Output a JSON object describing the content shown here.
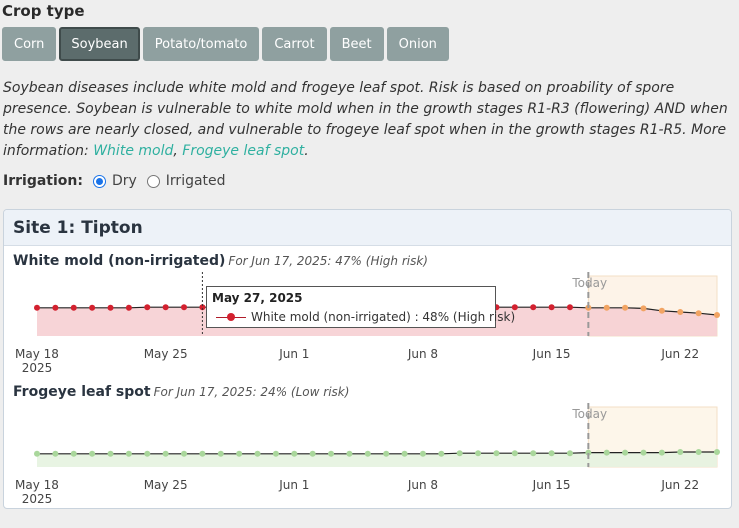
{
  "crop_type": {
    "title": "Crop type",
    "tabs": [
      "Corn",
      "Soybean",
      "Potato/tomato",
      "Carrot",
      "Beet",
      "Onion"
    ],
    "active": "Soybean"
  },
  "description": {
    "text": "Soybean diseases include white mold and frogeye leaf spot. Risk is based on proability of spore presence. Soybean is vulnerable to white mold when in the growth stages R1-R3 (flowering) AND when the rows are nearly closed, and vulnerable to frogeye leaf spot when in the growth stages R1-R5. More information: ",
    "link1": "White mold",
    "sep": ", ",
    "link2": "Frogeye leaf spot",
    "end": "."
  },
  "irrigation": {
    "label": "Irrigation:",
    "options": [
      "Dry",
      "Irrigated"
    ],
    "selected": "Dry"
  },
  "site": {
    "title": "Site 1: Tipton"
  },
  "charts": {
    "white_mold": {
      "title": "White mold (non-irrigated)",
      "subtitle": "For Jun 17, 2025: 47% (High risk)",
      "today_label": "Today",
      "tooltip": {
        "date": "May 27, 2025",
        "text": "White mold (non-irrigated) : 48% (High risk)"
      }
    },
    "frogeye": {
      "title": "Frogeye leaf spot",
      "subtitle": "For Jun 17, 2025: 24% (Low risk)",
      "today_label": "Today"
    },
    "x_ticks": [
      "May 18",
      "May 25",
      "Jun 1",
      "Jun 8",
      "Jun 15",
      "Jun 22"
    ],
    "x_year": "2025"
  },
  "chart_data": [
    {
      "type": "line",
      "title": "White mold (non-irrigated)",
      "x": [
        "2025-05-18",
        "2025-05-19",
        "2025-05-20",
        "2025-05-21",
        "2025-05-22",
        "2025-05-23",
        "2025-05-24",
        "2025-05-25",
        "2025-05-26",
        "2025-05-27",
        "2025-05-28",
        "2025-05-29",
        "2025-05-30",
        "2025-05-31",
        "2025-06-01",
        "2025-06-02",
        "2025-06-03",
        "2025-06-04",
        "2025-06-05",
        "2025-06-06",
        "2025-06-07",
        "2025-06-08",
        "2025-06-09",
        "2025-06-10",
        "2025-06-11",
        "2025-06-12",
        "2025-06-13",
        "2025-06-14",
        "2025-06-15",
        "2025-06-16",
        "2025-06-17",
        "2025-06-18",
        "2025-06-19",
        "2025-06-20",
        "2025-06-21",
        "2025-06-22",
        "2025-06-23",
        "2025-06-24"
      ],
      "series": [
        {
          "name": "White mold (non-irrigated)",
          "values": [
            47,
            47,
            47,
            47,
            47,
            47,
            48,
            48,
            48,
            48,
            48,
            48,
            48,
            48,
            48,
            48,
            48,
            48,
            48,
            48,
            48,
            48,
            48,
            48,
            48,
            48,
            48,
            48,
            48,
            48,
            47,
            47,
            47,
            46,
            42,
            40,
            38,
            35
          ]
        }
      ],
      "forecast_from": "2025-06-17",
      "risk_bands": {
        "high": "#f6cfd3",
        "forecast_bg": "#fdf3e8"
      }
    },
    {
      "type": "line",
      "title": "Frogeye leaf spot",
      "x": [
        "2025-05-18",
        "2025-05-19",
        "2025-05-20",
        "2025-05-21",
        "2025-05-22",
        "2025-05-23",
        "2025-05-24",
        "2025-05-25",
        "2025-05-26",
        "2025-05-27",
        "2025-05-28",
        "2025-05-29",
        "2025-05-30",
        "2025-05-31",
        "2025-06-01",
        "2025-06-02",
        "2025-06-03",
        "2025-06-04",
        "2025-06-05",
        "2025-06-06",
        "2025-06-07",
        "2025-06-08",
        "2025-06-09",
        "2025-06-10",
        "2025-06-11",
        "2025-06-12",
        "2025-06-13",
        "2025-06-14",
        "2025-06-15",
        "2025-06-16",
        "2025-06-17",
        "2025-06-18",
        "2025-06-19",
        "2025-06-20",
        "2025-06-21",
        "2025-06-22",
        "2025-06-23",
        "2025-06-24"
      ],
      "series": [
        {
          "name": "Frogeye leaf spot",
          "values": [
            22,
            22,
            22,
            22,
            22,
            22,
            22,
            22,
            22,
            22,
            22,
            22,
            22,
            22,
            22,
            22,
            22,
            22,
            22,
            22,
            22,
            22,
            22,
            23,
            23,
            23,
            23,
            23,
            23,
            23,
            24,
            24,
            24,
            24,
            24,
            25,
            25,
            25
          ]
        }
      ],
      "forecast_from": "2025-06-17",
      "risk_bands": {
        "low": "#e5f3e0",
        "forecast_bg": "#fdf6ea"
      }
    }
  ]
}
